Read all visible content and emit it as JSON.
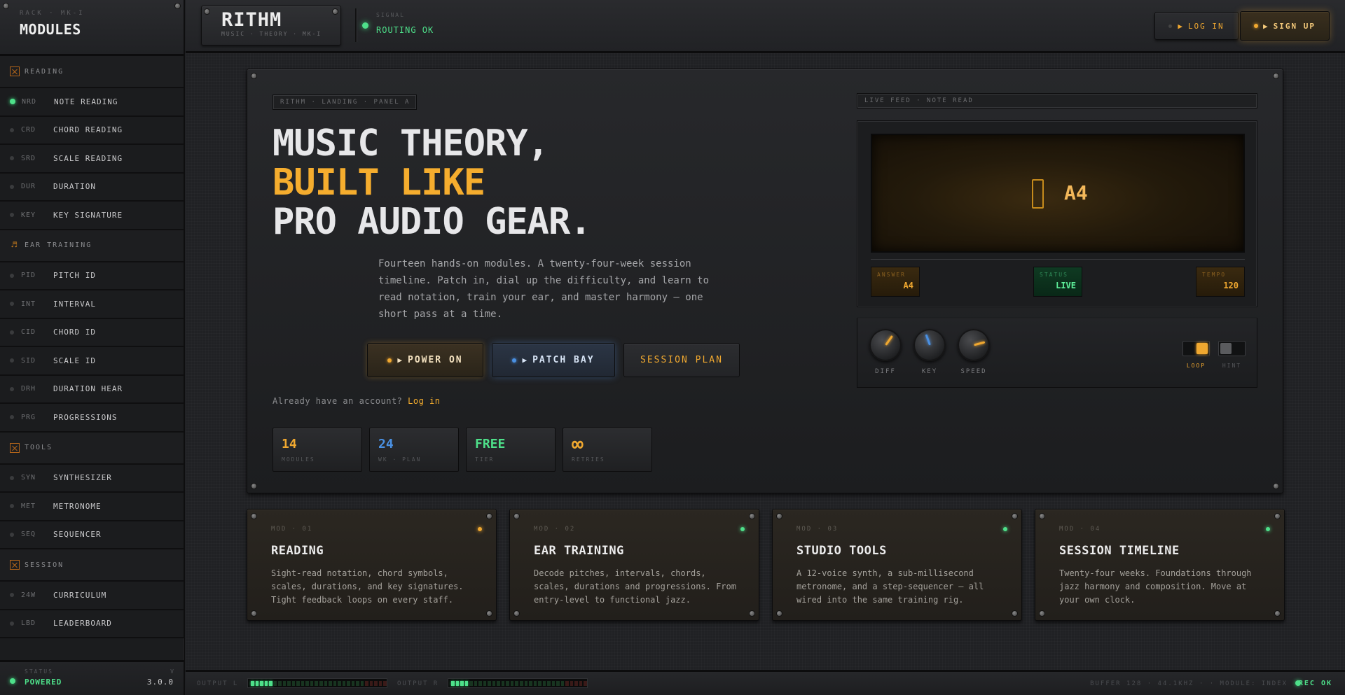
{
  "sidebar": {
    "rack_label": "RACK · MK-I",
    "title": "MODULES",
    "sections": [
      {
        "title": "READING",
        "icon": "crossed-box-icon",
        "items": [
          {
            "code": "NRD",
            "label": "NOTE READING",
            "active": true
          },
          {
            "code": "CRD",
            "label": "CHORD READING"
          },
          {
            "code": "SRD",
            "label": "SCALE READING"
          },
          {
            "code": "DUR",
            "label": "DURATION"
          },
          {
            "code": "KEY",
            "label": "KEY SIGNATURE"
          }
        ]
      },
      {
        "title": "EAR TRAINING",
        "icon": "music-note-icon",
        "items": [
          {
            "code": "PID",
            "label": "PITCH ID"
          },
          {
            "code": "INT",
            "label": "INTERVAL"
          },
          {
            "code": "CID",
            "label": "CHORD ID"
          },
          {
            "code": "SID",
            "label": "SCALE ID"
          },
          {
            "code": "DRH",
            "label": "DURATION HEAR"
          },
          {
            "code": "PRG",
            "label": "PROGRESSIONS"
          }
        ]
      },
      {
        "title": "TOOLS",
        "icon": "crossed-box-icon",
        "items": [
          {
            "code": "SYN",
            "label": "SYNTHESIZER"
          },
          {
            "code": "MET",
            "label": "METRONOME"
          },
          {
            "code": "SEQ",
            "label": "SEQUENCER"
          }
        ]
      },
      {
        "title": "SESSION",
        "icon": "crossed-box-icon",
        "items": [
          {
            "code": "24W",
            "label": "CURRICULUM"
          },
          {
            "code": "LBD",
            "label": "LEADERBOARD"
          }
        ]
      }
    ],
    "footer": {
      "status_label": "STATUS",
      "status": "POWERED",
      "version_label": "V",
      "version": "3.0.0"
    }
  },
  "topbar": {
    "logo": "RITHM",
    "tagline": "MUSIC · THEORY · MK-I",
    "signal_label": "SIGNAL",
    "signal_value": "ROUTING OK",
    "login": "LOG IN",
    "signup": "SIGN UP"
  },
  "hero": {
    "chip": "RITHM · LANDING · PANEL A",
    "title_line1": "MUSIC THEORY,",
    "title_line2": "BUILT LIKE",
    "title_line3": "PRO AUDIO GEAR.",
    "description": "Fourteen hands-on modules. A twenty-four-week session timeline. Patch in, dial up the difficulty, and learn to read notation, train your ear, and master harmony — one short pass at a time.",
    "cta_power": "POWER ON",
    "cta_patch": "PATCH BAY",
    "cta_session": "SESSION PLAN",
    "already_text": "Already have an account?",
    "already_link": "Log in",
    "stats": [
      {
        "value": "14",
        "label": "MODULES",
        "color": "#f0a830"
      },
      {
        "value": "24",
        "label": "WK · PLAN",
        "color": "#4a90e2"
      },
      {
        "value": "FREE",
        "label": "TIER",
        "color": "#4ee08a"
      },
      {
        "value": "∞",
        "label": "RETRIES",
        "color": "#f0a830"
      }
    ]
  },
  "feed": {
    "chip": "LIVE FEED · NOTE READ",
    "note": "A4",
    "answer_label": "ANSWER",
    "answer": "A4",
    "status_label": "STATUS",
    "status": "LIVE",
    "tempo_label": "TEMPO",
    "tempo": "120",
    "knobs": [
      {
        "label": "DIFF",
        "indicator_color": "#f0a830"
      },
      {
        "label": "KEY",
        "indicator_color": "#4a90e2"
      },
      {
        "label": "SPEED",
        "indicator_color": "#f0a830"
      }
    ],
    "toggles": [
      {
        "label": "LOOP",
        "on": true
      },
      {
        "label": "HINT",
        "on": false
      }
    ]
  },
  "modules": [
    {
      "id": "MOD · 01",
      "title": "READING",
      "desc": "Sight-read notation, chord symbols, scales, durations, and key signatures. Tight feedback loops on every staff.",
      "led": "#f0a830"
    },
    {
      "id": "MOD · 02",
      "title": "EAR TRAINING",
      "desc": "Decode pitches, intervals, chords, scales, durations and progressions. From entry-level to functional jazz.",
      "led": "#4ee08a"
    },
    {
      "id": "MOD · 03",
      "title": "STUDIO TOOLS",
      "desc": "A 12-voice synth, a sub-millisecond metronome, and a step-sequencer — all wired into the same training rig.",
      "led": "#4ee08a"
    },
    {
      "id": "MOD · 04",
      "title": "SESSION TIMELINE",
      "desc": "Twenty-four weeks. Foundations through jazz harmony and composition. Move at your own clock.",
      "led": "#4ee08a"
    }
  ],
  "statusbar": {
    "output_l": "OUTPUT L",
    "output_r": "OUTPUT R",
    "level_l": 0.18,
    "level_r": 0.13,
    "buffer": "BUFFER 128 · 44.1KHZ · · MODULE: INDEX",
    "rec": "REC OK"
  },
  "colors": {
    "amber": "#f5ad2e",
    "green": "#4ee08a",
    "blue": "#4a90e2"
  }
}
